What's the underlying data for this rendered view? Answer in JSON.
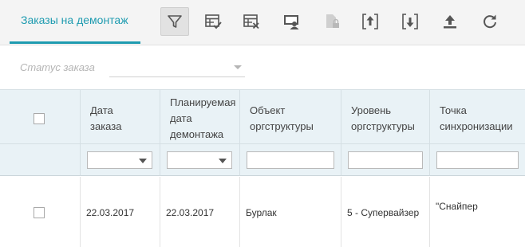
{
  "toolbar": {
    "tab_label": "Заказы на демонтаж",
    "buttons": [
      {
        "icon": "filter-icon"
      },
      {
        "icon": "table-check-icon"
      },
      {
        "icon": "table-delete-icon"
      },
      {
        "icon": "user-card-icon"
      },
      {
        "icon": "document-lock-icon"
      },
      {
        "icon": "upload-bracket-icon"
      },
      {
        "icon": "download-bracket-icon"
      },
      {
        "icon": "upload-icon"
      },
      {
        "icon": "refresh-icon"
      }
    ]
  },
  "filters": {
    "status_label": "Статус заказа",
    "status_value": ""
  },
  "grid": {
    "columns": [
      {
        "label": ""
      },
      {
        "label": "Дата\nзаказа"
      },
      {
        "label": "Планируемая\nдата\nдемонтажа"
      },
      {
        "label": "Объект\nоргструктуры"
      },
      {
        "label": "Уровень\nоргструктуры"
      },
      {
        "label": "Точка\nсинхронизации"
      }
    ],
    "rows": [
      {
        "checked": false,
        "order_date": "22.03.2017",
        "planned_date": "22.03.2017",
        "org_object": "Бурлак",
        "org_level": "5 - Супервайзер",
        "sync_point": "\"Снайпер"
      }
    ]
  },
  "colors": {
    "accent": "#1e9bb0",
    "header_bg": "#e9f2f6"
  }
}
